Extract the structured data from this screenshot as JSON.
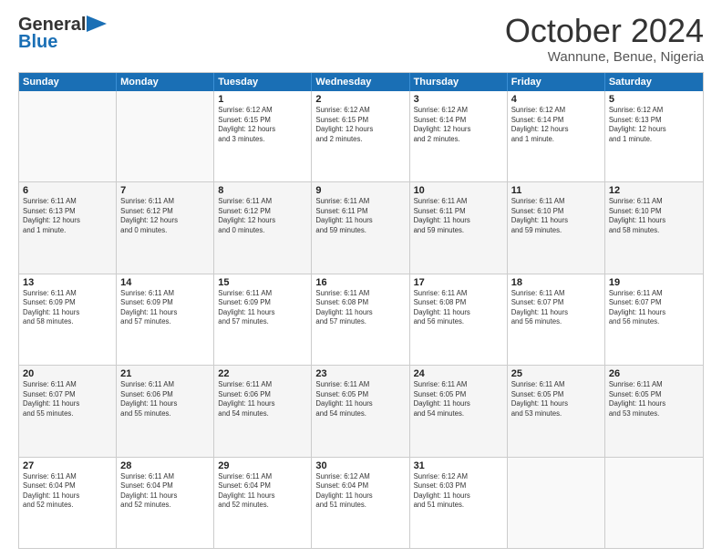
{
  "logo": {
    "line1": "General",
    "line2": "Blue"
  },
  "title": "October 2024",
  "location": "Wannune, Benue, Nigeria",
  "header_days": [
    "Sunday",
    "Monday",
    "Tuesday",
    "Wednesday",
    "Thursday",
    "Friday",
    "Saturday"
  ],
  "weeks": [
    [
      {
        "day": "",
        "info": ""
      },
      {
        "day": "",
        "info": ""
      },
      {
        "day": "1",
        "info": "Sunrise: 6:12 AM\nSunset: 6:15 PM\nDaylight: 12 hours\nand 3 minutes."
      },
      {
        "day": "2",
        "info": "Sunrise: 6:12 AM\nSunset: 6:15 PM\nDaylight: 12 hours\nand 2 minutes."
      },
      {
        "day": "3",
        "info": "Sunrise: 6:12 AM\nSunset: 6:14 PM\nDaylight: 12 hours\nand 2 minutes."
      },
      {
        "day": "4",
        "info": "Sunrise: 6:12 AM\nSunset: 6:14 PM\nDaylight: 12 hours\nand 1 minute."
      },
      {
        "day": "5",
        "info": "Sunrise: 6:12 AM\nSunset: 6:13 PM\nDaylight: 12 hours\nand 1 minute."
      }
    ],
    [
      {
        "day": "6",
        "info": "Sunrise: 6:11 AM\nSunset: 6:13 PM\nDaylight: 12 hours\nand 1 minute."
      },
      {
        "day": "7",
        "info": "Sunrise: 6:11 AM\nSunset: 6:12 PM\nDaylight: 12 hours\nand 0 minutes."
      },
      {
        "day": "8",
        "info": "Sunrise: 6:11 AM\nSunset: 6:12 PM\nDaylight: 12 hours\nand 0 minutes."
      },
      {
        "day": "9",
        "info": "Sunrise: 6:11 AM\nSunset: 6:11 PM\nDaylight: 11 hours\nand 59 minutes."
      },
      {
        "day": "10",
        "info": "Sunrise: 6:11 AM\nSunset: 6:11 PM\nDaylight: 11 hours\nand 59 minutes."
      },
      {
        "day": "11",
        "info": "Sunrise: 6:11 AM\nSunset: 6:10 PM\nDaylight: 11 hours\nand 59 minutes."
      },
      {
        "day": "12",
        "info": "Sunrise: 6:11 AM\nSunset: 6:10 PM\nDaylight: 11 hours\nand 58 minutes."
      }
    ],
    [
      {
        "day": "13",
        "info": "Sunrise: 6:11 AM\nSunset: 6:09 PM\nDaylight: 11 hours\nand 58 minutes."
      },
      {
        "day": "14",
        "info": "Sunrise: 6:11 AM\nSunset: 6:09 PM\nDaylight: 11 hours\nand 57 minutes."
      },
      {
        "day": "15",
        "info": "Sunrise: 6:11 AM\nSunset: 6:09 PM\nDaylight: 11 hours\nand 57 minutes."
      },
      {
        "day": "16",
        "info": "Sunrise: 6:11 AM\nSunset: 6:08 PM\nDaylight: 11 hours\nand 57 minutes."
      },
      {
        "day": "17",
        "info": "Sunrise: 6:11 AM\nSunset: 6:08 PM\nDaylight: 11 hours\nand 56 minutes."
      },
      {
        "day": "18",
        "info": "Sunrise: 6:11 AM\nSunset: 6:07 PM\nDaylight: 11 hours\nand 56 minutes."
      },
      {
        "day": "19",
        "info": "Sunrise: 6:11 AM\nSunset: 6:07 PM\nDaylight: 11 hours\nand 56 minutes."
      }
    ],
    [
      {
        "day": "20",
        "info": "Sunrise: 6:11 AM\nSunset: 6:07 PM\nDaylight: 11 hours\nand 55 minutes."
      },
      {
        "day": "21",
        "info": "Sunrise: 6:11 AM\nSunset: 6:06 PM\nDaylight: 11 hours\nand 55 minutes."
      },
      {
        "day": "22",
        "info": "Sunrise: 6:11 AM\nSunset: 6:06 PM\nDaylight: 11 hours\nand 54 minutes."
      },
      {
        "day": "23",
        "info": "Sunrise: 6:11 AM\nSunset: 6:05 PM\nDaylight: 11 hours\nand 54 minutes."
      },
      {
        "day": "24",
        "info": "Sunrise: 6:11 AM\nSunset: 6:05 PM\nDaylight: 11 hours\nand 54 minutes."
      },
      {
        "day": "25",
        "info": "Sunrise: 6:11 AM\nSunset: 6:05 PM\nDaylight: 11 hours\nand 53 minutes."
      },
      {
        "day": "26",
        "info": "Sunrise: 6:11 AM\nSunset: 6:05 PM\nDaylight: 11 hours\nand 53 minutes."
      }
    ],
    [
      {
        "day": "27",
        "info": "Sunrise: 6:11 AM\nSunset: 6:04 PM\nDaylight: 11 hours\nand 52 minutes."
      },
      {
        "day": "28",
        "info": "Sunrise: 6:11 AM\nSunset: 6:04 PM\nDaylight: 11 hours\nand 52 minutes."
      },
      {
        "day": "29",
        "info": "Sunrise: 6:11 AM\nSunset: 6:04 PM\nDaylight: 11 hours\nand 52 minutes."
      },
      {
        "day": "30",
        "info": "Sunrise: 6:12 AM\nSunset: 6:04 PM\nDaylight: 11 hours\nand 51 minutes."
      },
      {
        "day": "31",
        "info": "Sunrise: 6:12 AM\nSunset: 6:03 PM\nDaylight: 11 hours\nand 51 minutes."
      },
      {
        "day": "",
        "info": ""
      },
      {
        "day": "",
        "info": ""
      }
    ]
  ]
}
